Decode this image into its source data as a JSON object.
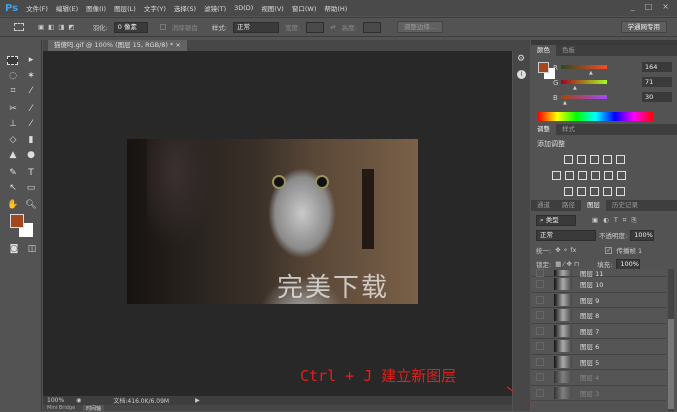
{
  "app": {
    "logo": "Ps",
    "menus": [
      "文件(F)",
      "编辑(E)",
      "图像(I)",
      "图层(L)",
      "文字(Y)",
      "选择(S)",
      "滤镜(T)",
      "3D(D)",
      "视图(V)",
      "窗口(W)",
      "帮助(H)"
    ],
    "window_controls": [
      "_",
      "□",
      "×"
    ]
  },
  "options": {
    "feather_label": "羽化:",
    "feather_value": "0 像素",
    "antialias_label": "消除锯齿",
    "style_label": "样式:",
    "style_value": "正常",
    "width_label": "宽度:",
    "height_label": "高度:",
    "refine_edge": "调整边缘...",
    "workspace": "学通网专用"
  },
  "document": {
    "tab_title": "猫傻吗.gif @ 100% (图层 15, RGB/8) *",
    "close": "×",
    "watermark": "完美下载",
    "zoom": "100%",
    "doc_info": "文档:416.0K/6.09M"
  },
  "bottom_tabs": [
    "Mini Bridge",
    "时间轴"
  ],
  "annotation": "Ctrl + J 建立新图层",
  "colors": {
    "foreground": "#a4471e",
    "background": "#ffffff",
    "annotation": "#e0201c"
  },
  "color_panel": {
    "tabs": [
      "颜色",
      "色板"
    ],
    "channels": [
      {
        "label": "R",
        "value": "164",
        "fraction": 0.64
      },
      {
        "label": "G",
        "value": "71",
        "fraction": 0.28
      },
      {
        "label": "B",
        "value": "30",
        "fraction": 0.12
      }
    ]
  },
  "adjust_panel": {
    "tabs": [
      "调整",
      "样式"
    ],
    "title": "添加调整"
  },
  "layers_panel": {
    "tabs": [
      "通道",
      "路径",
      "图层",
      "历史记录"
    ],
    "filter": "类型",
    "blend_mode": "正常",
    "opacity_label": "不透明度:",
    "opacity": "100%",
    "unify_label": "统一:",
    "propagate_label": "传播帧 1",
    "lock_label": "锁定:",
    "fill_label": "填充:",
    "fill": "100%",
    "layers": [
      "图层 11",
      "图层 10",
      "图层 9",
      "图层 8",
      "图层 7",
      "图层 6",
      "图层 5",
      "图层 4",
      "图层 3"
    ]
  }
}
